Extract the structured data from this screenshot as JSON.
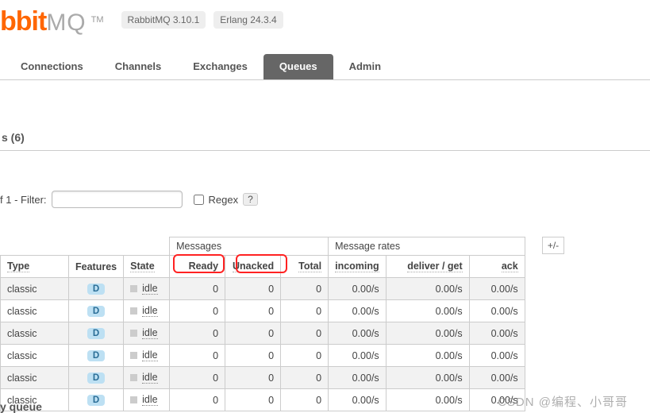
{
  "brand": {
    "prefix": "bbit",
    "suffix": "MQ",
    "tm": "TM"
  },
  "versions": {
    "rabbit": "RabbitMQ 3.10.1",
    "erlang": "Erlang 24.3.4"
  },
  "nav": {
    "items": [
      {
        "label": "Connections"
      },
      {
        "label": "Channels"
      },
      {
        "label": "Exchanges"
      },
      {
        "label": "Queues"
      },
      {
        "label": "Admin"
      }
    ],
    "active_index": 3
  },
  "section": {
    "title": "s (6)"
  },
  "filter": {
    "prefix": "f 1  - Filter:",
    "value": "",
    "regex_checked": false,
    "regex_label": "Regex",
    "help": "?"
  },
  "table": {
    "group_headers": {
      "messages": "Messages",
      "rates": "Message rates"
    },
    "plusminus": "+/-",
    "columns": {
      "type": "Type",
      "features": "Features",
      "state": "State",
      "ready": "Ready",
      "unacked": "Unacked",
      "total": "Total",
      "incoming": "incoming",
      "deliver_get": "deliver / get",
      "ack": "ack"
    },
    "rows": [
      {
        "type": "classic",
        "features": "D",
        "state": "idle",
        "ready": "0",
        "unacked": "0",
        "total": "0",
        "incoming": "0.00/s",
        "deliver_get": "0.00/s",
        "ack": "0.00/s"
      },
      {
        "type": "classic",
        "features": "D",
        "state": "idle",
        "ready": "0",
        "unacked": "0",
        "total": "0",
        "incoming": "0.00/s",
        "deliver_get": "0.00/s",
        "ack": "0.00/s"
      },
      {
        "type": "classic",
        "features": "D",
        "state": "idle",
        "ready": "0",
        "unacked": "0",
        "total": "0",
        "incoming": "0.00/s",
        "deliver_get": "0.00/s",
        "ack": "0.00/s"
      },
      {
        "type": "classic",
        "features": "D",
        "state": "idle",
        "ready": "0",
        "unacked": "0",
        "total": "0",
        "incoming": "0.00/s",
        "deliver_get": "0.00/s",
        "ack": "0.00/s"
      },
      {
        "type": "classic",
        "features": "D",
        "state": "idle",
        "ready": "0",
        "unacked": "0",
        "total": "0",
        "incoming": "0.00/s",
        "deliver_get": "0.00/s",
        "ack": "0.00/s"
      },
      {
        "type": "classic",
        "features": "D",
        "state": "idle",
        "ready": "0",
        "unacked": "0",
        "total": "0",
        "incoming": "0.00/s",
        "deliver_get": "0.00/s",
        "ack": "0.00/s"
      }
    ]
  },
  "footer": {
    "text": "y queue"
  },
  "watermark": "CSDN @编程、小哥哥"
}
